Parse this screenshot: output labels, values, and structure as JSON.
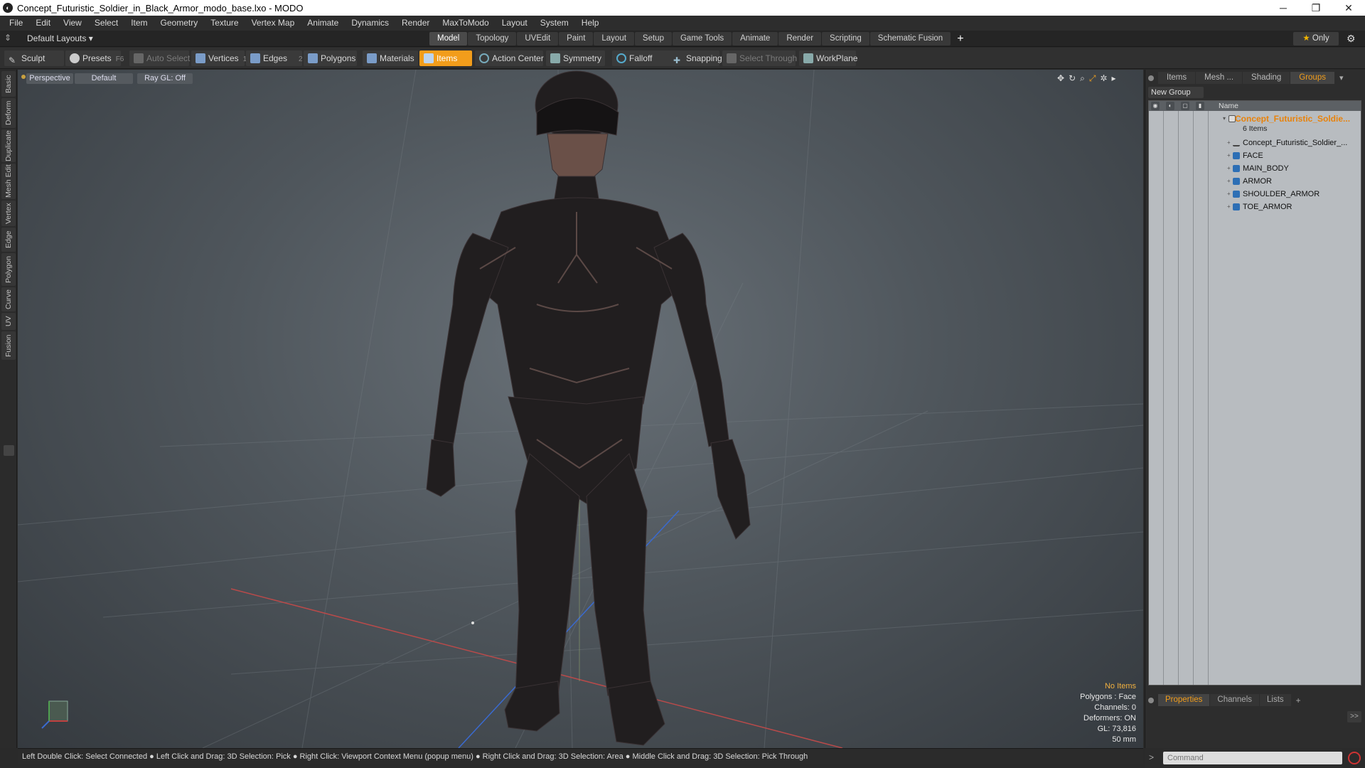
{
  "window": {
    "title": "Concept_Futuristic_Soldier_in_Black_Armor_modo_base.lxo - MODO",
    "minimize": "─",
    "maximize": "❐",
    "close": "✕"
  },
  "menu": [
    "File",
    "Edit",
    "View",
    "Select",
    "Item",
    "Geometry",
    "Texture",
    "Vertex Map",
    "Animate",
    "Dynamics",
    "Render",
    "MaxToModo",
    "Layout",
    "System",
    "Help"
  ],
  "layout_bar": {
    "layout_select": "Default Layouts ▾",
    "tabs": [
      "Model",
      "Topology",
      "UVEdit",
      "Paint",
      "Layout",
      "Setup",
      "Game Tools",
      "Animate",
      "Render",
      "Scripting",
      "Schematic Fusion"
    ],
    "active_tab": "Model",
    "only_label": "Only"
  },
  "toolbar": {
    "sculpt": "Sculpt",
    "presets": "Presets",
    "presets_key": "F6",
    "auto_select": "Auto Select",
    "vertices": "Vertices",
    "vertices_count": "1",
    "edges": "Edges",
    "edges_count": "2",
    "polygons": "Polygons",
    "materials": "Materials",
    "items": "Items",
    "action_center": "Action Center",
    "symmetry": "Symmetry",
    "falloff": "Falloff",
    "snapping": "Snapping",
    "select_through": "Select Through",
    "workplane": "WorkPlane"
  },
  "left_tabs": [
    "Basic",
    "Deform",
    "Duplicate",
    "Mesh Edit",
    "Vertex",
    "Edge",
    "Polygon",
    "Curve",
    "UV",
    "Fusion"
  ],
  "viewport": {
    "view": "Perspective",
    "shading": "Default",
    "raygl": "Ray GL: Off",
    "stats": {
      "selection": "No Items",
      "polygons": "Polygons : Face",
      "channels": "Channels: 0",
      "deformers": "Deformers: ON",
      "gl": "GL: 73,816",
      "size": "50 mm"
    }
  },
  "status_bar": "Left Double Click: Select Connected ● Left Click and Drag: 3D Selection: Pick ● Right Click: Viewport Context Menu (popup menu) ● Right Click and Drag: 3D Selection: Area ● Middle Click and Drag: 3D Selection: Pick Through",
  "right_panel": {
    "tabs": [
      "Items",
      "Mesh ...",
      "Shading",
      "Groups"
    ],
    "active_tab": "Groups",
    "new_group": "New Group",
    "name_header": "Name",
    "group": {
      "name": "Concept_Futuristic_Soldie...",
      "count": "6 Items",
      "children": [
        "Concept_Futuristic_Soldier_...",
        "FACE",
        "MAIN_BODY",
        "ARMOR",
        "SHOULDER_ARMOR",
        "TOE_ARMOR"
      ]
    },
    "prop_tabs": [
      "Properties",
      "Channels",
      "Lists"
    ],
    "active_prop_tab": "Properties",
    "command_placeholder": "Command"
  },
  "colors": {
    "accent": "#f29d1b",
    "group_name": "#e8820a",
    "x_axis": "#c04040",
    "z_axis": "#3a6ad0"
  }
}
